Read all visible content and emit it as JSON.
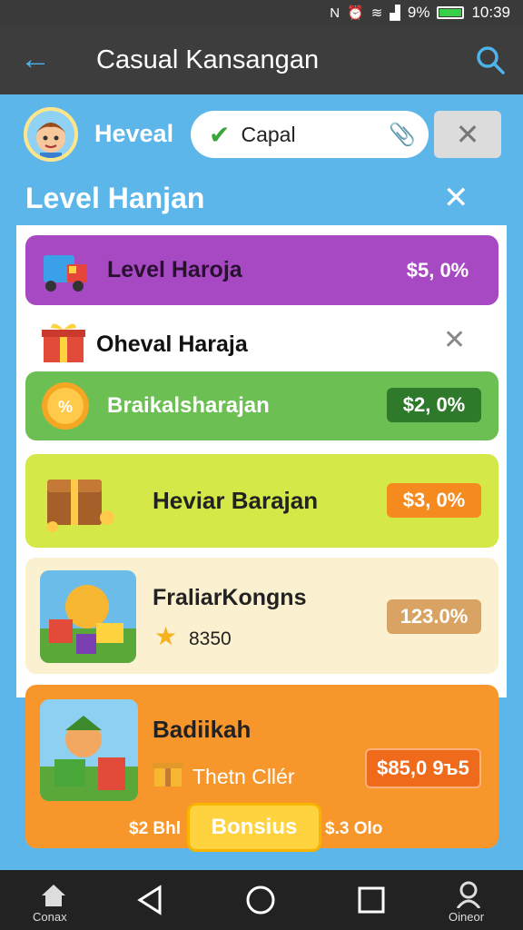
{
  "status_bar": {
    "battery_percent": "9%",
    "time": "10:39",
    "icons": [
      "nfc-icon",
      "alarm-icon",
      "wifi-icon",
      "signal-icon",
      "battery-icon"
    ]
  },
  "app_bar": {
    "title": "Casual Kansangan",
    "back_icon": "back-arrow-icon",
    "search_icon": "search-icon"
  },
  "profile": {
    "name": "Heveal",
    "search_value": "Capal"
  },
  "section": {
    "title": "Level Hanjan"
  },
  "items": [
    {
      "label": "Level Haroja",
      "price": "$5, 0%",
      "color": "#a849c4"
    },
    {
      "label": "Oheval Haraja"
    },
    {
      "label": "Braikalsharajan",
      "price": "$2, 0%",
      "color": "#6cbf52"
    },
    {
      "label": "Heviar Barajan",
      "price": "$3, 0%",
      "color": "#d4e847"
    },
    {
      "label": "FraliarKongns",
      "price": "123.0%",
      "sub": "8350",
      "color": "#fbf0cf"
    },
    {
      "label": "Badiikah",
      "price": "$85,0 9ъ5",
      "sub": "Thetn Cllér",
      "color": "#f7962b"
    }
  ],
  "bottom_texts": {
    "left": "$2 Bhl",
    "bonus": "Bonsius",
    "right": "$.3 Olo"
  },
  "nav": {
    "home_label": "Conax",
    "account_label": "Oineor"
  }
}
